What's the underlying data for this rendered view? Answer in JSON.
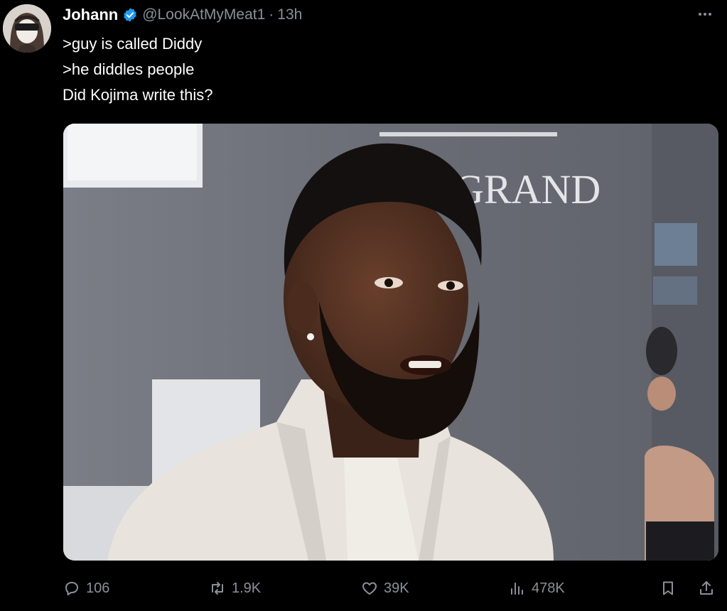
{
  "tweet": {
    "display_name": "Johann",
    "handle": "@LookAtMyMeat1",
    "separator": "·",
    "time": "13h",
    "lines": [
      ">guy is called Diddy",
      ">he diddles people",
      "Did Kojima write this?"
    ],
    "media": {
      "sign_text": "GRAND"
    }
  },
  "actions": {
    "replies": "106",
    "reposts": "1.9K",
    "likes": "39K",
    "views": "478K"
  },
  "colors": {
    "verified": "#1d9bf0",
    "muted": "#8b9096",
    "background": "#000000"
  }
}
